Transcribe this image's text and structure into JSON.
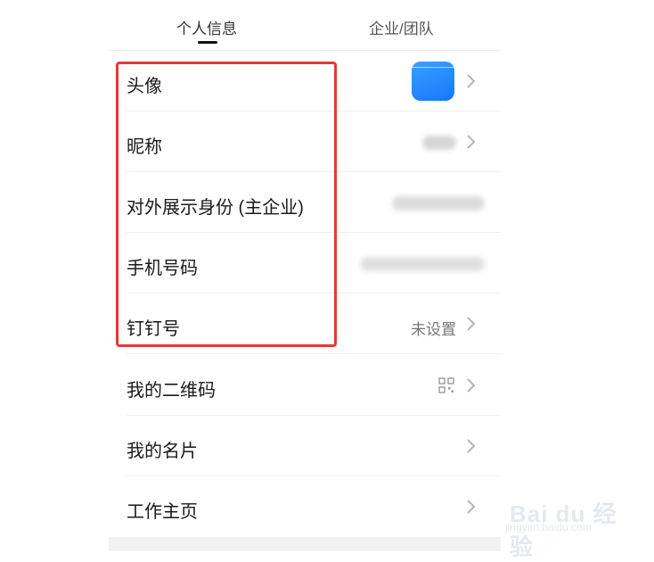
{
  "tabs": [
    {
      "label": "个人信息",
      "active": true
    },
    {
      "label": "企业/团队",
      "active": false
    }
  ],
  "rows": [
    {
      "label": "头像",
      "value": ""
    },
    {
      "label": "昵称",
      "value": ""
    },
    {
      "label": "对外展示身份 (主企业)",
      "value": ""
    },
    {
      "label": "手机号码",
      "value": ""
    },
    {
      "label": "钉钉号",
      "value": "未设置"
    },
    {
      "label": "我的二维码",
      "value": ""
    },
    {
      "label": "我的名片",
      "value": ""
    },
    {
      "label": "工作主页",
      "value": ""
    }
  ],
  "icons": {
    "chevron": "chevron-right-icon",
    "qr": "qr-code-icon",
    "avatar": "avatar-image"
  },
  "colors": {
    "highlight": "#e53935",
    "avatar": "#1677ff"
  },
  "watermark": {
    "main": "Bai du 经验",
    "sub": "jingyan.baidu.com"
  }
}
